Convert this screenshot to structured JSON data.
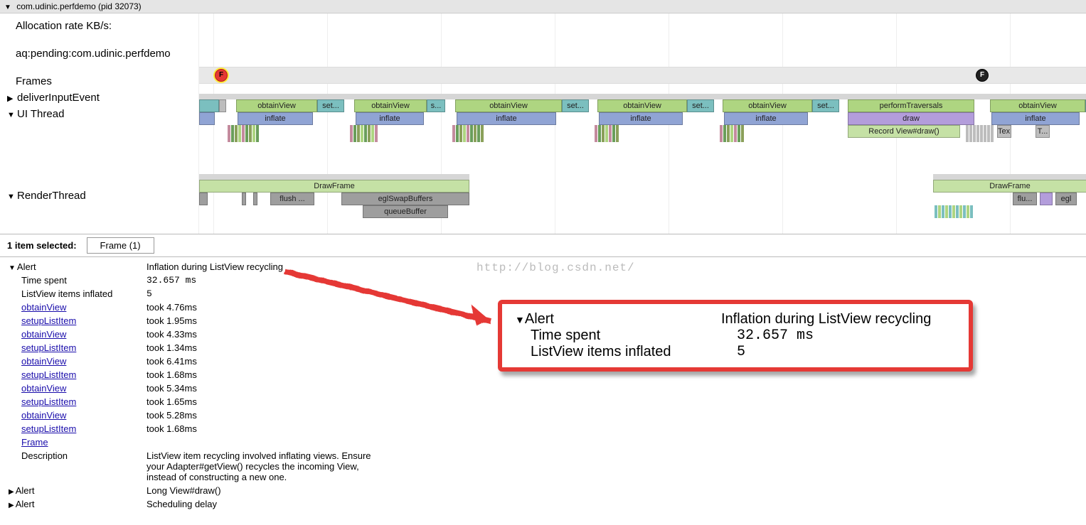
{
  "header": {
    "process": "com.udinic.perfdemo (pid 32073)"
  },
  "sidebar": {
    "alloc": "Allocation rate KB/s:",
    "aq": "aq:pending:com.udinic.perfdemo",
    "frames": "Frames",
    "deliver": "deliverInputEvent",
    "ui": "UI Thread",
    "render": "RenderThread"
  },
  "trace": {
    "obtainView": "obtainView",
    "set": "set...",
    "s": "s...",
    "inflate": "inflate",
    "performTraversals": "performTraversals",
    "draw": "draw",
    "recordDraw": "Record View#draw()",
    "tex": "Tex...",
    "t": "T...",
    "drawFrame": "DrawFrame",
    "flush": "flush ...",
    "eglSwap": "eglSwapBuffers",
    "queueBuffer": "queueBuffer",
    "flu": "flu...",
    "egl": "egl"
  },
  "selection": {
    "count": "1 item selected:",
    "tab": "Frame (1)"
  },
  "alert": {
    "title": "Alert",
    "name": "Inflation during ListView recycling",
    "timeSpentLabel": "Time spent",
    "timeSpentVal": "32.657 ms",
    "inflatedLabel": "ListView items inflated",
    "inflatedVal": "5",
    "rows": [
      {
        "k": "obtainView",
        "v": "took 4.76ms"
      },
      {
        "k": "setupListItem",
        "v": "took 1.95ms"
      },
      {
        "k": "obtainView",
        "v": "took 4.33ms"
      },
      {
        "k": "setupListItem",
        "v": "took 1.34ms"
      },
      {
        "k": "obtainView",
        "v": "took 6.41ms"
      },
      {
        "k": "setupListItem",
        "v": "took 1.68ms"
      },
      {
        "k": "obtainView",
        "v": "took 5.34ms"
      },
      {
        "k": "setupListItem",
        "v": "took 1.65ms"
      },
      {
        "k": "obtainView",
        "v": "took 5.28ms"
      },
      {
        "k": "setupListItem",
        "v": "took 1.68ms"
      },
      {
        "k": "Frame",
        "v": ""
      }
    ],
    "descLabel": "Description",
    "descVal": "ListView item recycling involved inflating views. Ensure your Adapter#getView() recycles the incoming View, instead of constructing a new one.",
    "alert2Label": "Alert",
    "alert2Val": "Long View#draw()",
    "alert3Label": "Alert",
    "alert3Val": "Scheduling delay"
  },
  "watermark": "http://blog.csdn.net/"
}
